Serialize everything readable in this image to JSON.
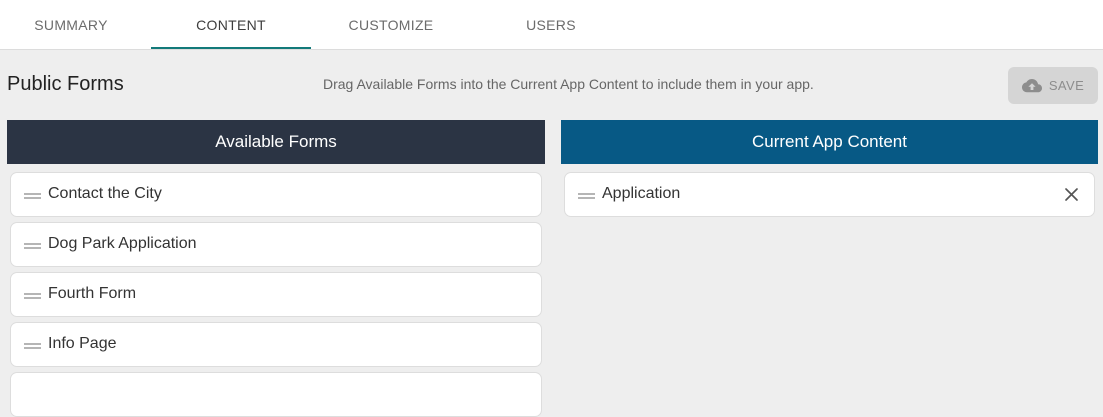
{
  "tabs": [
    {
      "label": "SUMMARY"
    },
    {
      "label": "CONTENT"
    },
    {
      "label": "CUSTOMIZE"
    },
    {
      "label": "USERS"
    }
  ],
  "active_tab": "CONTENT",
  "colors": {
    "accent": "#137a7a",
    "available_header_bg": "#2b3444",
    "current_header_bg": "#075985",
    "page_bg": "#eeeeee"
  },
  "header": {
    "title": "Public Forms",
    "instructions": "Drag Available Forms into the Current App Content to include them in your app.",
    "save_label": "SAVE",
    "save_icon": "cloud-upload-icon"
  },
  "available": {
    "title": "Available Forms",
    "items": [
      {
        "label": "Contact the City"
      },
      {
        "label": "Dog Park Application"
      },
      {
        "label": "Fourth Form"
      },
      {
        "label": "Info Page"
      }
    ]
  },
  "current": {
    "title": "Current App Content",
    "items": [
      {
        "label": "Application",
        "remove_icon": "close-icon"
      }
    ]
  }
}
